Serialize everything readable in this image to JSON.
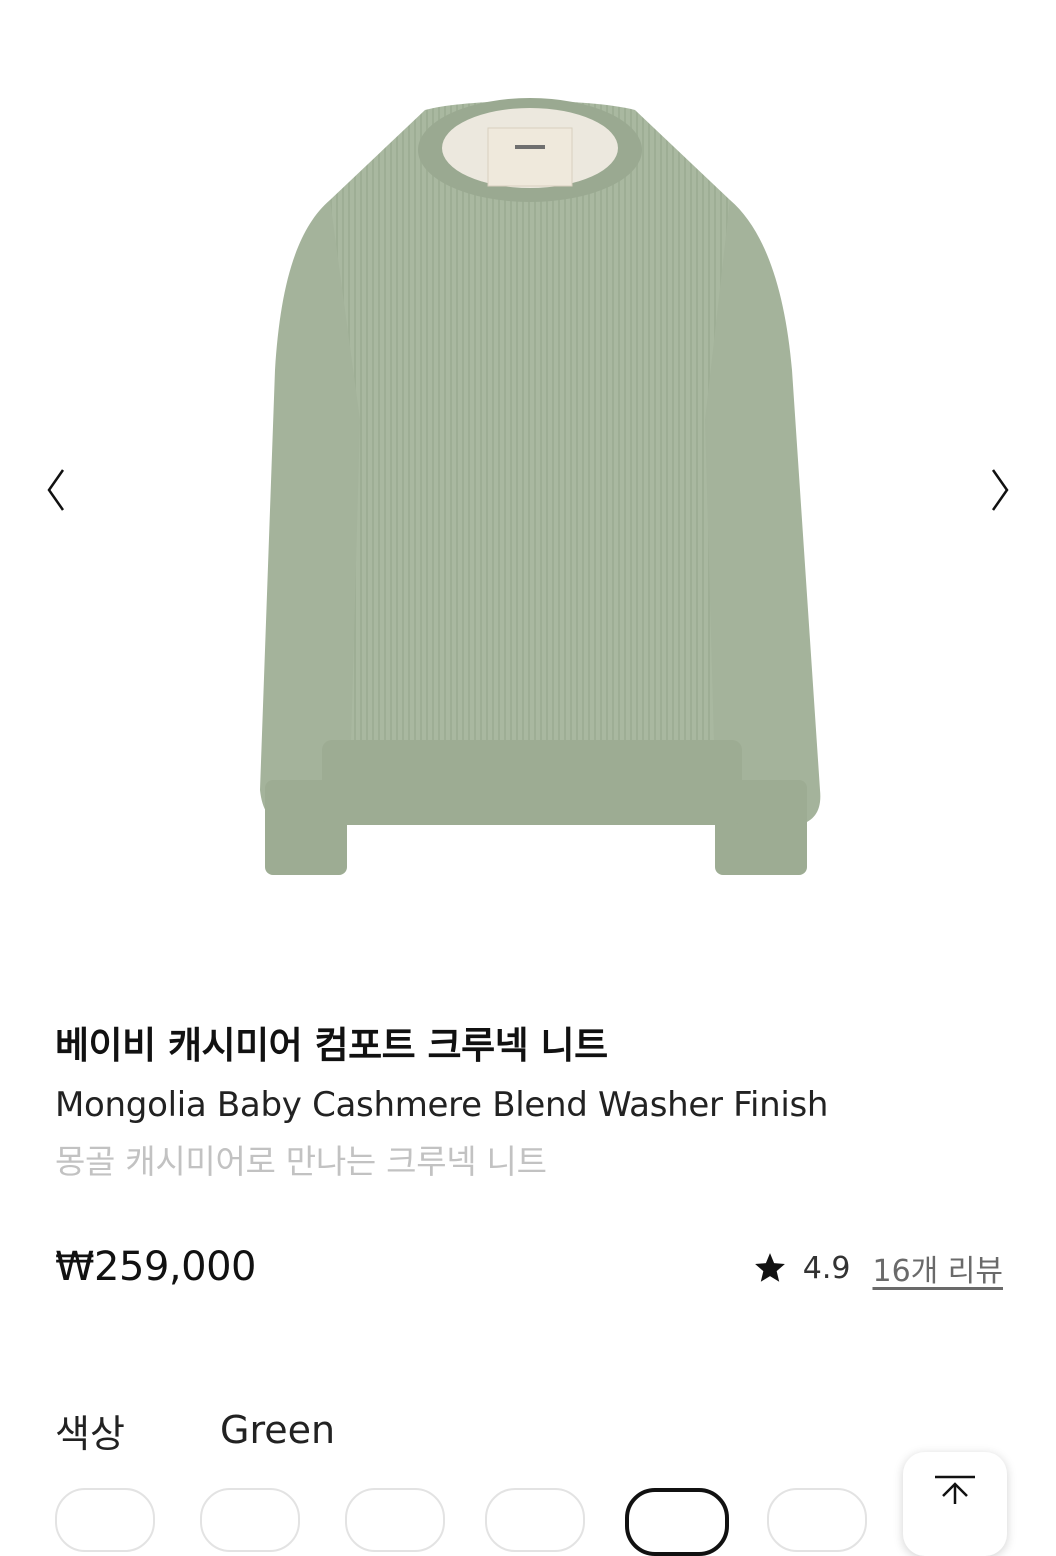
{
  "gallery": {
    "image_name": "sage-green-cashmere-crewneck-sweater",
    "prev_icon": "chevron-left-icon",
    "next_icon": "chevron-right-icon"
  },
  "product": {
    "name_ko": "베이비 캐시미어 컴포트 크루넥 니트",
    "name_en": "Mongolia Baby Cashmere Blend Washer Finish",
    "subtitle": "몽골 캐시미어로 만나는 크루넥 니트",
    "price": "₩259,000",
    "rating": "4.9",
    "review_link": "16개 리뷰",
    "rating_icon": "star-icon"
  },
  "options": {
    "color_label": "색상",
    "color_value": "Green",
    "swatch_count_visible": 6,
    "selected_swatch_index": 4
  },
  "floating": {
    "top_button_icon": "arrow-up-to-top-icon"
  },
  "colors": {
    "sweater": "#a9b8a0",
    "text_primary": "#111111",
    "text_muted": "#c2c2c2",
    "link": "#6a6a6a"
  }
}
